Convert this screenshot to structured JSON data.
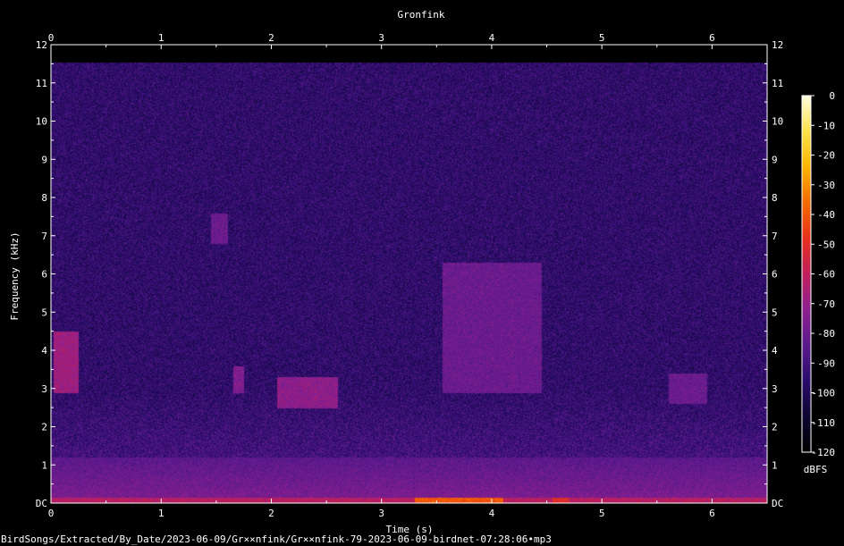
{
  "chart_data": {
    "type": "heatmap",
    "title": "Gronfink",
    "xlabel": "Time (s)",
    "ylabel": "Frequency (kHz)",
    "xlim": [
      0,
      6.5
    ],
    "ylim": [
      0,
      12
    ],
    "x_ticks": [
      "0",
      "1",
      "2",
      "3",
      "4",
      "5",
      "6"
    ],
    "y_ticks": [
      "DC",
      "1",
      "2",
      "3",
      "4",
      "5",
      "6",
      "7",
      "8",
      "9",
      "10",
      "11",
      "12"
    ],
    "colorbar": {
      "label": "dBFS",
      "range": [
        -120,
        0
      ],
      "ticks": [
        "0",
        "-10",
        "-20",
        "-30",
        "-40",
        "-50",
        "-60",
        "-70",
        "-80",
        "-90",
        "-100",
        "-110",
        "-120"
      ],
      "colormap": [
        "#000000",
        "#0c0530",
        "#2a0c6b",
        "#5a1a8c",
        "#8d1f8f",
        "#c01f5a",
        "#e8301c",
        "#f46a00",
        "#fbb400",
        "#fde34a",
        "#fffde0"
      ]
    },
    "background_level_dbfs": -95,
    "low_band": {
      "freq_range_khz": [
        0,
        1.2
      ],
      "level_dbfs": -75
    },
    "energy_regions": [
      {
        "t_start": 0.02,
        "t_end": 0.25,
        "f_low": 2.9,
        "f_high": 4.5,
        "level_dbfs": -68
      },
      {
        "t_start": 1.45,
        "t_end": 1.6,
        "f_low": 6.8,
        "f_high": 7.6,
        "level_dbfs": -80
      },
      {
        "t_start": 1.65,
        "t_end": 1.75,
        "f_low": 2.9,
        "f_high": 3.6,
        "level_dbfs": -75
      },
      {
        "t_start": 2.05,
        "t_end": 2.6,
        "f_low": 2.5,
        "f_high": 3.3,
        "level_dbfs": -72
      },
      {
        "t_start": 3.55,
        "t_end": 4.45,
        "f_low": 2.9,
        "f_high": 6.3,
        "level_dbfs": -80
      },
      {
        "t_start": 5.6,
        "t_end": 5.95,
        "f_low": 2.6,
        "f_high": 3.4,
        "level_dbfs": -80
      },
      {
        "t_start": 3.3,
        "t_end": 4.1,
        "f_low": 0.0,
        "f_high": 0.15,
        "level_dbfs": -40
      },
      {
        "t_start": 4.55,
        "t_end": 4.7,
        "f_low": 0.0,
        "f_high": 0.15,
        "level_dbfs": -50
      }
    ]
  },
  "footer": {
    "path": "BirdSongs/Extracted/By_Date/2023-06-09/Gr××nfink/Gr××nfink-79-2023-06-09-birdnet-07:28:06•mp3"
  }
}
